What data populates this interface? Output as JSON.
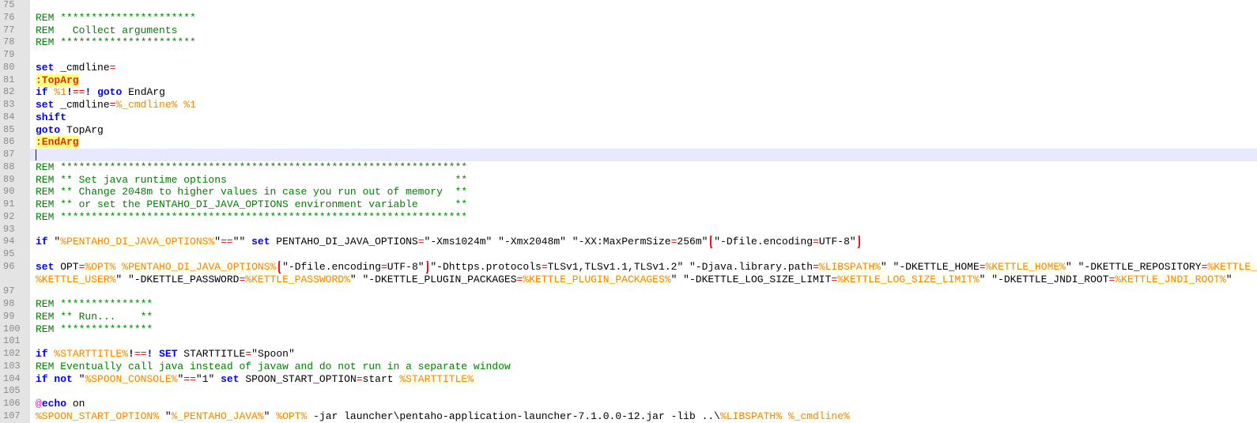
{
  "editor": {
    "current_line": "87",
    "lines": [
      {
        "num": "75",
        "tokens": []
      },
      {
        "num": "76",
        "tokens": [
          [
            "c",
            "REM **********************"
          ]
        ]
      },
      {
        "num": "77",
        "tokens": [
          [
            "c",
            "REM   Collect arguments"
          ]
        ]
      },
      {
        "num": "78",
        "tokens": [
          [
            "c",
            "REM **********************"
          ]
        ]
      },
      {
        "num": "79",
        "tokens": []
      },
      {
        "num": "80",
        "tokens": [
          [
            "k",
            "set"
          ],
          [
            "t",
            " _cmdline"
          ],
          [
            "o",
            "="
          ]
        ]
      },
      {
        "num": "81",
        "tokens": [
          [
            "l",
            ":TopArg"
          ]
        ]
      },
      {
        "num": "82",
        "tokens": [
          [
            "k",
            "if"
          ],
          [
            "t",
            " "
          ],
          [
            "v",
            "%1"
          ],
          [
            "k",
            "!"
          ],
          [
            "o",
            "=="
          ],
          [
            "k",
            "!"
          ],
          [
            "t",
            " "
          ],
          [
            "k",
            "goto"
          ],
          [
            "t",
            " EndArg"
          ]
        ]
      },
      {
        "num": "83",
        "tokens": [
          [
            "k",
            "set"
          ],
          [
            "t",
            " _cmdline"
          ],
          [
            "o",
            "="
          ],
          [
            "v",
            "%_cmdline%"
          ],
          [
            "t",
            " "
          ],
          [
            "v",
            "%1"
          ]
        ]
      },
      {
        "num": "84",
        "tokens": [
          [
            "k",
            "shift"
          ]
        ]
      },
      {
        "num": "85",
        "tokens": [
          [
            "k",
            "goto"
          ],
          [
            "t",
            " TopArg"
          ]
        ]
      },
      {
        "num": "86",
        "tokens": [
          [
            "l",
            ":EndArg"
          ]
        ]
      },
      {
        "num": "87",
        "tokens": [],
        "current": true
      },
      {
        "num": "88",
        "tokens": [
          [
            "c",
            "REM ******************************************************************"
          ]
        ]
      },
      {
        "num": "89",
        "tokens": [
          [
            "c",
            "REM ** Set java runtime options                                     **"
          ]
        ]
      },
      {
        "num": "90",
        "tokens": [
          [
            "c",
            "REM ** Change 2048m to higher values in case you run out of memory  **"
          ]
        ]
      },
      {
        "num": "91",
        "tokens": [
          [
            "c",
            "REM ** or set the PENTAHO_DI_JAVA_OPTIONS environment variable      **"
          ]
        ]
      },
      {
        "num": "92",
        "tokens": [
          [
            "c",
            "REM ******************************************************************"
          ]
        ]
      },
      {
        "num": "93",
        "tokens": []
      },
      {
        "num": "94",
        "tokens": [
          [
            "k",
            "if"
          ],
          [
            "t",
            " \""
          ],
          [
            "v",
            "%PENTAHO_DI_JAVA_OPTIONS%"
          ],
          [
            "t",
            "\""
          ],
          [
            "o",
            "=="
          ],
          [
            "t",
            "\"\" "
          ],
          [
            "k",
            "set"
          ],
          [
            "t",
            " PENTAHO_DI_JAVA_OPTIONS"
          ],
          [
            "o",
            "="
          ],
          [
            "t",
            "\"-Xms1024m\" \"-Xmx2048m\" \"-XX:MaxPermSize"
          ],
          [
            "o",
            "="
          ],
          [
            "t",
            "256m\" "
          ],
          [
            "bs",
            ""
          ],
          [
            "t",
            "\"-Dfile.encoding"
          ],
          [
            "o",
            "="
          ],
          [
            "t",
            "UTF-8\""
          ],
          [
            "be",
            ""
          ]
        ]
      },
      {
        "num": "95",
        "tokens": []
      },
      {
        "num": "96",
        "tokens": [
          [
            "k",
            "set"
          ],
          [
            "t",
            " OPT"
          ],
          [
            "o",
            "="
          ],
          [
            "v",
            "%OPT%"
          ],
          [
            "t",
            " "
          ],
          [
            "v",
            "%PENTAHO_DI_JAVA_OPTIONS%"
          ],
          [
            "t",
            " "
          ],
          [
            "bs",
            ""
          ],
          [
            "t",
            "\"-Dfile.encoding"
          ],
          [
            "o",
            "="
          ],
          [
            "t",
            "UTF-8\""
          ],
          [
            "be",
            ""
          ],
          [
            "t",
            " \"-Dhttps.protocols"
          ],
          [
            "o",
            "="
          ],
          [
            "t",
            "TLSv1,TLSv1.1,TLSv1.2\" \"-Djava.library.path"
          ],
          [
            "o",
            "="
          ],
          [
            "v",
            "%LIBSPATH%"
          ],
          [
            "t",
            "\" \"-DKETTLE_HOME"
          ],
          [
            "o",
            "="
          ],
          [
            "v",
            "%KETTLE_HOME%"
          ],
          [
            "t",
            "\" \"-DKETTLE_REPOSITORY"
          ],
          [
            "o",
            "="
          ],
          [
            "v",
            "%KETTLE_REPOSITORY%"
          ]
        ]
      },
      {
        "num": "",
        "tokens": [
          [
            "v",
            "%KETTLE_USER%"
          ],
          [
            "t",
            "\" \"-DKETTLE_PASSWORD"
          ],
          [
            "o",
            "="
          ],
          [
            "v",
            "%KETTLE_PASSWORD%"
          ],
          [
            "t",
            "\" \"-DKETTLE_PLUGIN_PACKAGES"
          ],
          [
            "o",
            "="
          ],
          [
            "v",
            "%KETTLE_PLUGIN_PACKAGES%"
          ],
          [
            "t",
            "\" \"-DKETTLE_LOG_SIZE_LIMIT"
          ],
          [
            "o",
            "="
          ],
          [
            "v",
            "%KETTLE_LOG_SIZE_LIMIT%"
          ],
          [
            "t",
            "\" \"-DKETTLE_JNDI_ROOT"
          ],
          [
            "o",
            "="
          ],
          [
            "v",
            "%KETTLE_JNDI_ROOT%"
          ],
          [
            "t",
            "\""
          ]
        ]
      },
      {
        "num": "97",
        "tokens": []
      },
      {
        "num": "98",
        "tokens": [
          [
            "c",
            "REM ***************"
          ]
        ]
      },
      {
        "num": "99",
        "tokens": [
          [
            "c",
            "REM ** Run...    **"
          ]
        ]
      },
      {
        "num": "100",
        "tokens": [
          [
            "c",
            "REM ***************"
          ]
        ]
      },
      {
        "num": "101",
        "tokens": []
      },
      {
        "num": "102",
        "tokens": [
          [
            "k",
            "if"
          ],
          [
            "t",
            " "
          ],
          [
            "v",
            "%STARTTITLE%"
          ],
          [
            "k",
            "!"
          ],
          [
            "o",
            "=="
          ],
          [
            "k",
            "!"
          ],
          [
            "t",
            " "
          ],
          [
            "k",
            "SET"
          ],
          [
            "t",
            " STARTTITLE"
          ],
          [
            "o",
            "="
          ],
          [
            "t",
            "\"Spoon\""
          ]
        ]
      },
      {
        "num": "103",
        "tokens": [
          [
            "c",
            "REM Eventually call java instead of javaw and do not run in a separate window"
          ]
        ]
      },
      {
        "num": "104",
        "tokens": [
          [
            "k",
            "if"
          ],
          [
            "t",
            " "
          ],
          [
            "k",
            "not"
          ],
          [
            "t",
            " \""
          ],
          [
            "v",
            "%SPOON_CONSOLE%"
          ],
          [
            "t",
            "\""
          ],
          [
            "o",
            "=="
          ],
          [
            "t",
            "\"1\" "
          ],
          [
            "k",
            "set"
          ],
          [
            "t",
            " SPOON_START_OPTION"
          ],
          [
            "o",
            "="
          ],
          [
            "t",
            "start "
          ],
          [
            "v",
            "%STARTTITLE%"
          ]
        ]
      },
      {
        "num": "105",
        "tokens": []
      },
      {
        "num": "106",
        "tokens": [
          [
            "a",
            "@"
          ],
          [
            "k",
            "echo"
          ],
          [
            "t",
            " on"
          ]
        ]
      },
      {
        "num": "107",
        "tokens": [
          [
            "v",
            "%SPOON_START_OPTION%"
          ],
          [
            "t",
            " \""
          ],
          [
            "v",
            "%_PENTAHO_JAVA%"
          ],
          [
            "t",
            "\" "
          ],
          [
            "v",
            "%OPT%"
          ],
          [
            "t",
            " -jar launcher\\pentaho-application-launcher-7.1.0.0-12.jar -lib ..\\"
          ],
          [
            "v",
            "%LIBSPATH%"
          ],
          [
            "t",
            " "
          ],
          [
            "v",
            "%_cmdline%"
          ]
        ]
      }
    ]
  },
  "colors": {
    "comment": "#008000",
    "keyword": "#0000FF",
    "operator": "#FF0000",
    "variable": "#FF8000",
    "label_bg": "#FFFF80",
    "current_line_bg": "#E8E8FF",
    "annotation_box": "#E8141C"
  }
}
